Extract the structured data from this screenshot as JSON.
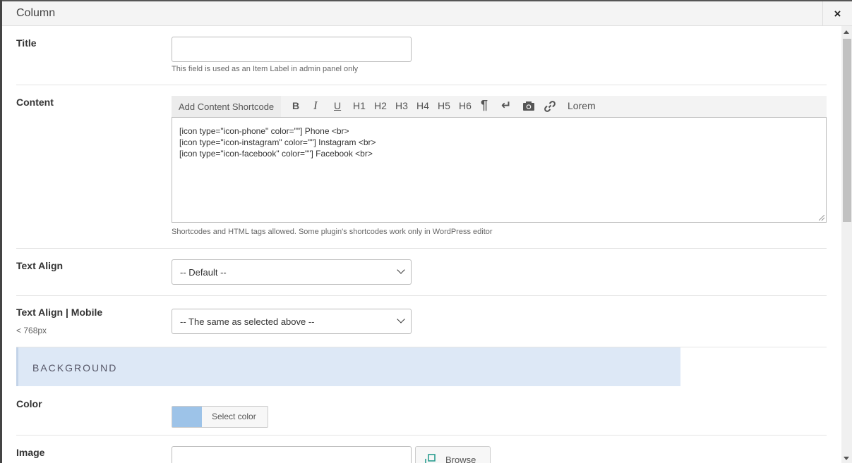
{
  "modal": {
    "title": "Column",
    "close_label": "×"
  },
  "fields": {
    "title": {
      "label": "Title",
      "value": "",
      "hint": "This field is used as an Item Label in admin panel only"
    },
    "content": {
      "label": "Content",
      "toolbar": {
        "shortcode_label": "Add Content Shortcode",
        "bold": "B",
        "italic": "I",
        "underline": "U",
        "h1": "H1",
        "h2": "H2",
        "h3": "H3",
        "h4": "H4",
        "h5": "H5",
        "h6": "H6",
        "paragraph": "¶",
        "linebreak": "↵",
        "lorem": "Lorem"
      },
      "lines": [
        "[icon type=\"icon-phone\" color=\"\"] Phone <br>",
        "[icon type=\"icon-instagram\" color=\"\"] Instagram <br>",
        "[icon type=\"icon-facebook\" color=\"\"] Facebook <br>"
      ],
      "hint": "Shortcodes and HTML tags allowed. Some plugin's shortcodes work only in WordPress editor"
    },
    "text_align": {
      "label": "Text Align",
      "selected": "-- Default --"
    },
    "text_align_mobile": {
      "label": "Text Align | Mobile",
      "sublabel": "< 768px",
      "selected": "-- The same as selected above --"
    },
    "background_section": {
      "title": "BACKGROUND"
    },
    "color": {
      "label": "Color",
      "swatch": "#9dc3e8",
      "button_label": "Select color"
    },
    "image": {
      "label": "Image",
      "value": "",
      "browse_label": "Browse"
    }
  }
}
